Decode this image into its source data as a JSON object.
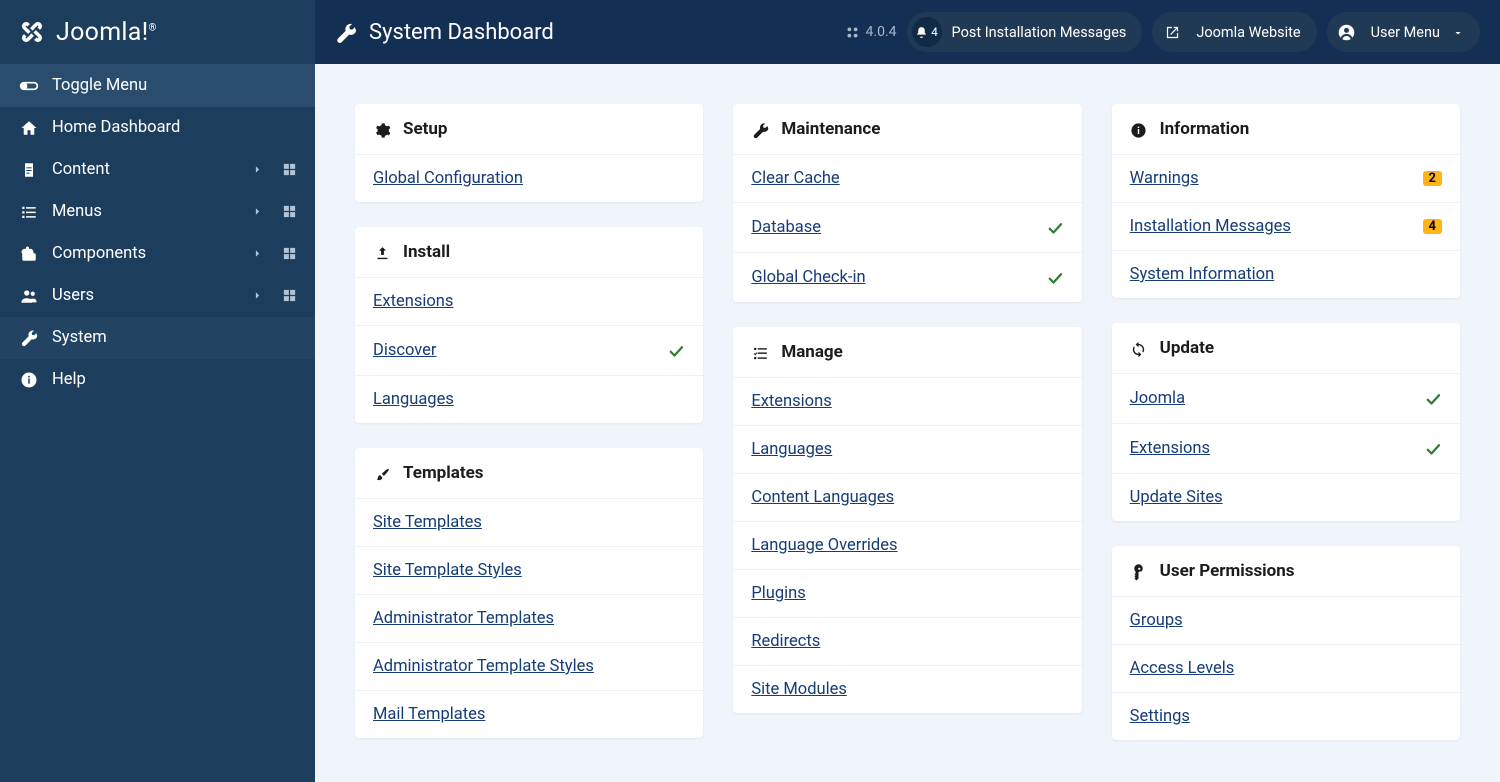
{
  "brand": "Joomla!",
  "sidebar": {
    "items": [
      {
        "icon": "toggle",
        "label": "Toggle Menu",
        "type": "toggle"
      },
      {
        "icon": "home",
        "label": "Home Dashboard",
        "type": "link"
      },
      {
        "icon": "file",
        "label": "Content",
        "type": "expand"
      },
      {
        "icon": "list",
        "label": "Menus",
        "type": "expand"
      },
      {
        "icon": "puzzle",
        "label": "Components",
        "type": "expand"
      },
      {
        "icon": "users",
        "label": "Users",
        "type": "expand"
      },
      {
        "icon": "wrench",
        "label": "System",
        "type": "link",
        "active": true
      },
      {
        "icon": "info",
        "label": "Help",
        "type": "link"
      }
    ]
  },
  "header": {
    "page_title": "System Dashboard",
    "version": "4.0.4",
    "notif_count": "4",
    "notif_label": "Post Installation Messages",
    "website_label": "Joomla Website",
    "user_menu_label": "User Menu"
  },
  "columns": [
    [
      {
        "icon": "cog",
        "title": "Setup",
        "items": [
          {
            "label": "Global Configuration"
          }
        ]
      },
      {
        "icon": "upload",
        "title": "Install",
        "items": [
          {
            "label": "Extensions"
          },
          {
            "label": "Discover",
            "check": true
          },
          {
            "label": "Languages"
          }
        ]
      },
      {
        "icon": "brush",
        "title": "Templates",
        "items": [
          {
            "label": "Site Templates"
          },
          {
            "label": "Site Template Styles"
          },
          {
            "label": "Administrator Templates"
          },
          {
            "label": "Administrator Template Styles"
          },
          {
            "label": "Mail Templates"
          }
        ]
      }
    ],
    [
      {
        "icon": "wrench",
        "title": "Maintenance",
        "items": [
          {
            "label": "Clear Cache"
          },
          {
            "label": "Database",
            "check": true
          },
          {
            "label": "Global Check-in",
            "check": true
          }
        ]
      },
      {
        "icon": "tasks",
        "title": "Manage",
        "items": [
          {
            "label": "Extensions"
          },
          {
            "label": "Languages"
          },
          {
            "label": "Content Languages"
          },
          {
            "label": "Language Overrides"
          },
          {
            "label": "Plugins"
          },
          {
            "label": "Redirects"
          },
          {
            "label": "Site Modules"
          }
        ]
      }
    ],
    [
      {
        "icon": "info",
        "title": "Information",
        "items": [
          {
            "label": "Warnings",
            "badge": "2"
          },
          {
            "label": "Installation Messages",
            "badge": "4"
          },
          {
            "label": "System Information"
          }
        ]
      },
      {
        "icon": "sync",
        "title": "Update",
        "items": [
          {
            "label": "Joomla",
            "check": true
          },
          {
            "label": "Extensions",
            "check": true
          },
          {
            "label": "Update Sites"
          }
        ]
      },
      {
        "icon": "key",
        "title": "User Permissions",
        "items": [
          {
            "label": "Groups"
          },
          {
            "label": "Access Levels"
          },
          {
            "label": "Settings"
          }
        ]
      }
    ]
  ]
}
